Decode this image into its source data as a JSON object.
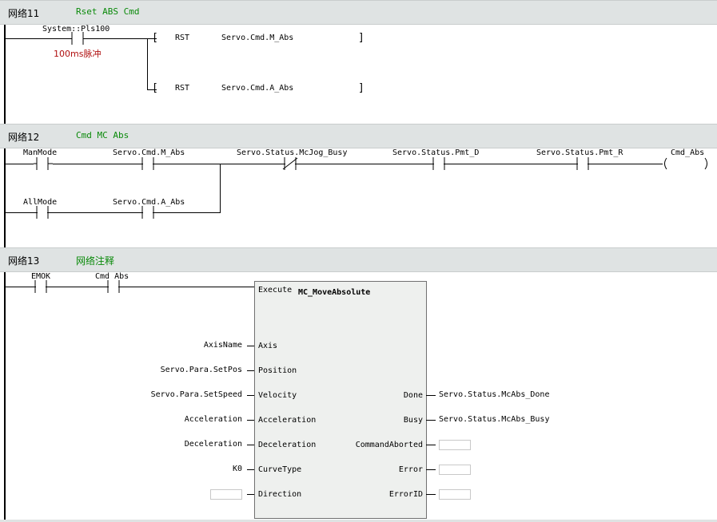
{
  "networks": [
    {
      "label": "网络11",
      "comment": "Rset ABS Cmd"
    },
    {
      "label": "网络12",
      "comment": "Cmd MC Abs"
    },
    {
      "label": "网络13",
      "comment": "网络注释"
    }
  ],
  "net11": {
    "contact": "System::Pls100",
    "contact_comment": "100ms脉冲",
    "rungs": [
      {
        "instr": "RST",
        "operand": "Servo.Cmd.M_Abs"
      },
      {
        "instr": "RST",
        "operand": "Servo.Cmd.A_Abs"
      }
    ]
  },
  "net12": {
    "contacts": [
      "ManMode",
      "Servo.Cmd.M_Abs",
      "Servo.Status.McJog_Busy",
      "Servo.Status.Pmt_D",
      "Servo.Status.Pmt_R",
      "AllMode",
      "Servo.Cmd.A_Abs"
    ],
    "coil": "Cmd_Abs"
  },
  "net13": {
    "contacts": [
      "EMOK",
      "Cmd_Abs"
    ],
    "block_name": "MC_MoveAbsolute",
    "execute": "Execute",
    "inputs": [
      {
        "pin": "Axis",
        "value": "AxisName"
      },
      {
        "pin": "Position",
        "value": "Servo.Para.SetPos"
      },
      {
        "pin": "Velocity",
        "value": "Servo.Para.SetSpeed"
      },
      {
        "pin": "Acceleration",
        "value": "Acceleration"
      },
      {
        "pin": "Deceleration",
        "value": "Deceleration"
      },
      {
        "pin": "CurveType",
        "value": "K0"
      },
      {
        "pin": "Direction",
        "value": ""
      }
    ],
    "outputs": [
      {
        "pin": "Done",
        "value": "Servo.Status.McAbs_Done"
      },
      {
        "pin": "Busy",
        "value": "Servo.Status.McAbs_Busy"
      },
      {
        "pin": "CommandAborted",
        "value": ""
      },
      {
        "pin": "Error",
        "value": ""
      },
      {
        "pin": "ErrorID",
        "value": ""
      }
    ]
  }
}
